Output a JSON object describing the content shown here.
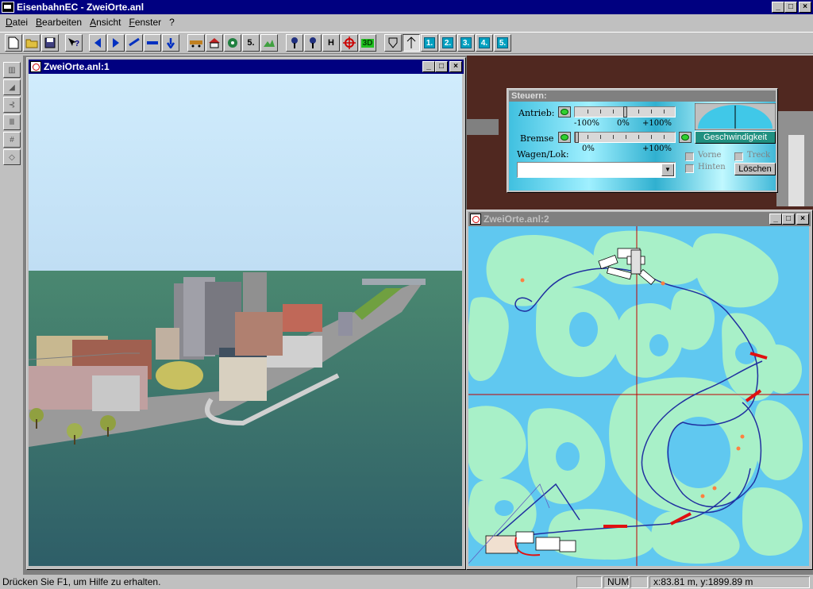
{
  "app": {
    "title": "EisenbahnEC - ZweiOrte.anl",
    "caption_buttons": [
      "_",
      "□",
      "×"
    ]
  },
  "menu": {
    "items": [
      "Datei",
      "Bearbeiten",
      "Ansicht",
      "Fenster",
      "?"
    ]
  },
  "toolbar": {
    "labels": {
      "number5": "5.",
      "h": "H",
      "three_d": "3D",
      "layer1": "1.",
      "layer2": "2.",
      "layer3": "3.",
      "layer4": "4.",
      "layer5": "5."
    }
  },
  "windows": {
    "view3d": {
      "title": "ZweiOrte.anl:1"
    },
    "map": {
      "title": "ZweiOrte.anl:2"
    }
  },
  "steuern": {
    "title": "Steuern:",
    "antrieb_label": "Antrieb:",
    "antrieb_scale": [
      "-100%",
      "0%",
      "+100%"
    ],
    "antrieb_value_percent": 0,
    "bremse_label": "Bremse",
    "bremse_scale": [
      "0%",
      "+100%"
    ],
    "bremse_value_percent": 0,
    "speed_button": "Geschwindigkeit",
    "wagen_label": "Wagen/Lok:",
    "wagen_value": "",
    "vorne_label": "Vorne",
    "treck_label": "Treck",
    "hinten_label": "Hinten",
    "loeschen_button": "Löschen"
  },
  "status": {
    "help": "Drücken Sie F1, um Hilfe zu erhalten.",
    "num": "NUM",
    "coords": "x:83.81 m, y:1899.89 m"
  },
  "colors": {
    "titlebar": "#000080",
    "sky": "#c8e4f8",
    "ground": "#3a7070",
    "water": "#60c8f0",
    "land": "#a8f0c8",
    "track": "#2030a0",
    "track_highlight": "#e01010",
    "crosshair": "#c00000"
  }
}
